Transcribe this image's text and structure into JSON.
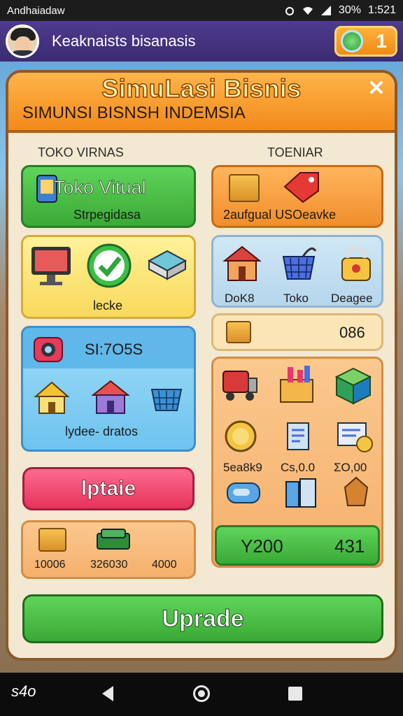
{
  "status_bar": {
    "app": "Andhaiadaw",
    "battery": "30%",
    "time": "1:521"
  },
  "header": {
    "title": "Keaknaists bisanasis",
    "coins": "1"
  },
  "panel": {
    "title": "SimuLasi Bisnis",
    "subtitle": "SIMUNSI BISNSH INDEMSIA",
    "close": "✕"
  },
  "left": {
    "label": "TOKO VIRNAS",
    "toko_card": {
      "title": "Toko Vitual",
      "sub": "Strpegidasa"
    },
    "yellow_card": {
      "label": "lecke"
    },
    "blue_card": {
      "title": "SI:7O5S",
      "label": "lydee- dratos"
    },
    "update_button": "lptaie",
    "bottom": {
      "v1": "10006",
      "v2": "326030",
      "v3": "4000"
    }
  },
  "right": {
    "label": "TOENIAR",
    "orange_card": {
      "label": "2aufgual USOeavke"
    },
    "shop_row": {
      "l1": "DoK8",
      "l2": "Toko",
      "l3": "Deagee"
    },
    "stat_row": {
      "value": "086"
    },
    "items": {
      "p1": "5ea8k9",
      "p2": "Cs,0.0",
      "p3": "ΣO,00"
    },
    "green_bar": {
      "left": "Y200",
      "right": "431"
    }
  },
  "upgrade_button": "Uprade",
  "nav": {
    "logo": "s4o"
  },
  "colors": {
    "accent": "#f28a1a",
    "green": "#3aa936",
    "purple": "#3b2b72"
  }
}
